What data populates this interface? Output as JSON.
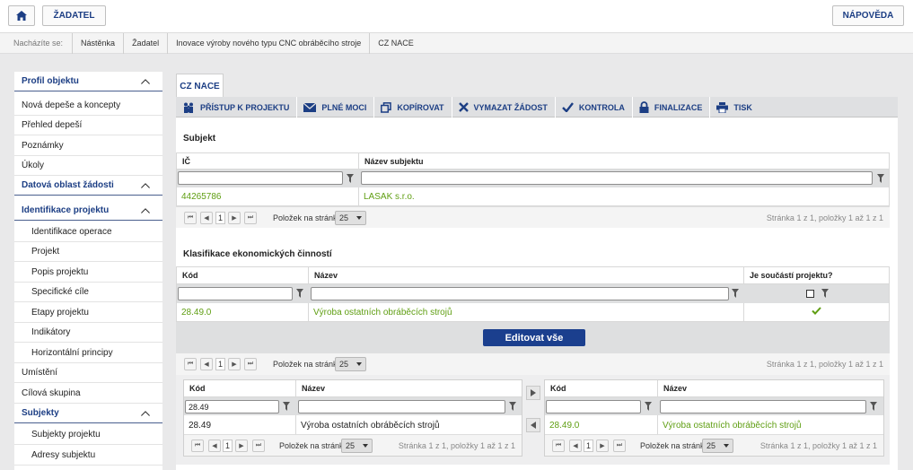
{
  "topbar": {
    "home_icon": "home-icon",
    "zadatel": "ŽADATEL",
    "napoveda": "NÁPOVĚDA"
  },
  "breadcrumb": {
    "label": "Nacházíte se:",
    "items": [
      "Nástěnka",
      "Žadatel",
      "Inovace výroby nového typu CNC obráběcího stroje",
      "CZ NACE"
    ]
  },
  "sidebar": {
    "items": [
      {
        "label": "Profil objektu",
        "type": "section"
      },
      {
        "label": "Nová depeše a koncepty",
        "type": "item"
      },
      {
        "label": "Přehled depeší",
        "type": "item"
      },
      {
        "label": "Poznámky",
        "type": "item"
      },
      {
        "label": "Úkoly",
        "type": "item"
      },
      {
        "label": "Datová oblast žádosti",
        "type": "section"
      },
      {
        "label": "Identifikace projektu",
        "type": "section"
      },
      {
        "label": "Identifikace operace",
        "type": "sub"
      },
      {
        "label": "Projekt",
        "type": "sub"
      },
      {
        "label": "Popis projektu",
        "type": "sub"
      },
      {
        "label": "Specifické cíle",
        "type": "sub"
      },
      {
        "label": "Etapy projektu",
        "type": "sub"
      },
      {
        "label": "Indikátory",
        "type": "sub"
      },
      {
        "label": "Horizontální principy",
        "type": "sub"
      },
      {
        "label": "Umístění",
        "type": "item"
      },
      {
        "label": "Cílová skupina",
        "type": "item"
      },
      {
        "label": "Subjekty",
        "type": "section"
      },
      {
        "label": "Subjekty projektu",
        "type": "sub"
      },
      {
        "label": "Adresy subjektu",
        "type": "sub"
      }
    ]
  },
  "tab": {
    "label": "CZ NACE"
  },
  "toolbar": [
    {
      "label": "PŘÍSTUP K PROJEKTU",
      "icon": "people-icon"
    },
    {
      "label": "PLNÉ MOCI",
      "icon": "envelope-icon"
    },
    {
      "label": "KOPÍROVAT",
      "icon": "copy-icon"
    },
    {
      "label": "VYMAZAT ŽÁDOST",
      "icon": "delete-icon"
    },
    {
      "label": "KONTROLA",
      "icon": "check-icon"
    },
    {
      "label": "FINALIZACE",
      "icon": "lock-icon"
    },
    {
      "label": "TISK",
      "icon": "print-icon"
    }
  ],
  "subjekt": {
    "title": "Subjekt",
    "col_ic": "IČ",
    "col_nazev": "Název subjektu",
    "row": {
      "ic": "44265786",
      "nazev": "LASAK s.r.o."
    },
    "pager": {
      "page": "1",
      "label": "Položek na stránku",
      "size": "25",
      "info": "Stránka 1 z 1, položky 1 až 1 z 1"
    }
  },
  "klasifikace": {
    "title": "Klasifikace ekonomických činností",
    "col_kod": "Kód",
    "col_nazev": "Název",
    "col_soucast": "Je součástí projektu?",
    "row": {
      "kod": "28.49.0",
      "nazev": "Výroba ostatních obráběcích strojů"
    },
    "edit_button": "Editovat vše",
    "pager": {
      "page": "1",
      "label": "Položek na stránku",
      "size": "25",
      "info": "Stránka 1 z 1, položky 1 až 1 z 1"
    }
  },
  "left_list": {
    "col_kod": "Kód",
    "col_nazev": "Název",
    "filter_kod": "28.49",
    "row": {
      "kod": "28.49",
      "nazev": "Výroba ostatních obráběcích strojů"
    },
    "pager": {
      "page": "1",
      "label": "Položek na stránku",
      "size": "25",
      "info": "Stránka 1 z 1, položky 1 až 1 z 1"
    }
  },
  "right_list": {
    "col_kod": "Kód",
    "col_nazev": "Název",
    "row": {
      "kod": "28.49.0",
      "nazev": "Výroba ostatních obráběcích strojů"
    },
    "pager": {
      "page": "1",
      "label": "Položek na stránku",
      "size": "25",
      "info": "Stránka 1 z 1, položky 1 až 1 z 1"
    }
  },
  "colors": {
    "accent": "#1b3f8e",
    "green": "#5f9e12"
  }
}
